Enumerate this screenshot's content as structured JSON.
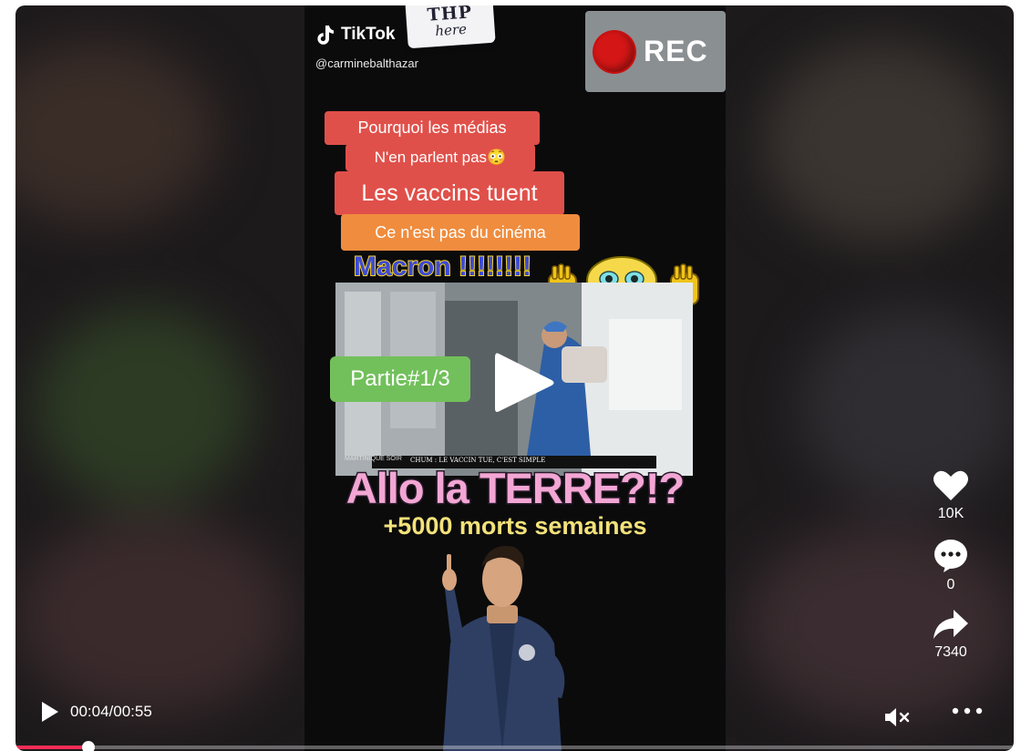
{
  "video_overlay": {
    "app_logo": "TikTok",
    "handle": "@carminebalthazar",
    "sticker_big": "THP",
    "sticker_small": "here",
    "rec_label": "REC",
    "captions": [
      "Pourquoi les médias",
      "N'en parlent pas😳",
      "Les vaccins tuent",
      "Ce n'est pas du cinéma"
    ],
    "macron_text": "Macron !!!!!!!!",
    "clip_banner": "CHUM : LE VACCIN TUE, C'EST SIMPLE",
    "clip_source": "MARTINIQUE SOIR",
    "partie_label": "Partie#1/3",
    "headline": "Allo la TERRE?!?",
    "subheadline": "+5000 morts semaines"
  },
  "actions": {
    "like_count": "10K",
    "comment_count": "0",
    "share_count": "7340"
  },
  "controls": {
    "time": "00:04/00:55",
    "progress": 0.073
  },
  "colors": {
    "caption_red": "#e0504a",
    "caption_orange": "#f08c3e",
    "partie_green": "#72c05b",
    "progress_accent": "#fe2c55"
  },
  "icons": [
    "play-icon",
    "heart-icon",
    "comment-icon",
    "share-icon",
    "mute-icon",
    "more-icon"
  ]
}
